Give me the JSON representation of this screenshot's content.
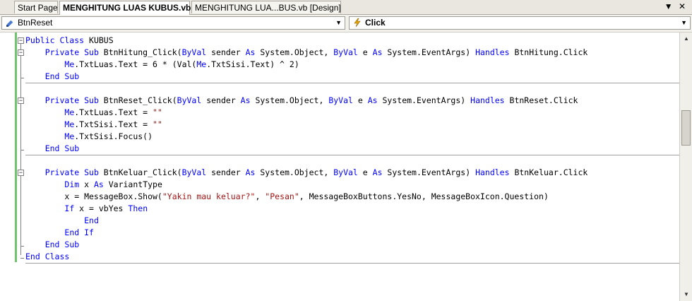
{
  "tabs": [
    {
      "label": "Start Page"
    },
    {
      "label": "MENGHITUNG LUAS KUBUS.vb"
    },
    {
      "label": "MENGHITUNG LUA...BUS.vb [Design]"
    }
  ],
  "tab_controls": {
    "dropdown": "▼",
    "close": "✕"
  },
  "navbar": {
    "object_combo": {
      "value": "BtnReset",
      "icon": "object-icon"
    },
    "member_combo": {
      "value": "Click",
      "icon": "lightning-icon"
    }
  },
  "code_lines": [
    [
      {
        "t": "kw",
        "v": "Public Class"
      },
      {
        "t": "p",
        "v": " KUBUS"
      }
    ],
    [
      {
        "t": "p",
        "v": "    "
      },
      {
        "t": "kw",
        "v": "Private Sub"
      },
      {
        "t": "p",
        "v": " BtnHitung_Click("
      },
      {
        "t": "kw",
        "v": "ByVal"
      },
      {
        "t": "p",
        "v": " sender "
      },
      {
        "t": "kw",
        "v": "As"
      },
      {
        "t": "p",
        "v": " System.Object, "
      },
      {
        "t": "kw",
        "v": "ByVal"
      },
      {
        "t": "p",
        "v": " e "
      },
      {
        "t": "kw",
        "v": "As"
      },
      {
        "t": "p",
        "v": " System.EventArgs) "
      },
      {
        "t": "kw",
        "v": "Handles"
      },
      {
        "t": "p",
        "v": " BtnHitung.Click"
      }
    ],
    [
      {
        "t": "p",
        "v": "        "
      },
      {
        "t": "kw",
        "v": "Me"
      },
      {
        "t": "p",
        "v": ".TxtLuas.Text = 6 * (Val("
      },
      {
        "t": "kw",
        "v": "Me"
      },
      {
        "t": "p",
        "v": ".TxtSisi.Text) ^ 2)"
      }
    ],
    [
      {
        "t": "p",
        "v": "    "
      },
      {
        "t": "kw",
        "v": "End Sub"
      }
    ],
    [
      {
        "t": "p",
        "v": ""
      }
    ],
    [
      {
        "t": "p",
        "v": "    "
      },
      {
        "t": "kw",
        "v": "Private Sub"
      },
      {
        "t": "p",
        "v": " BtnReset_Click("
      },
      {
        "t": "kw",
        "v": "ByVal"
      },
      {
        "t": "p",
        "v": " sender "
      },
      {
        "t": "kw",
        "v": "As"
      },
      {
        "t": "p",
        "v": " System.Object, "
      },
      {
        "t": "kw",
        "v": "ByVal"
      },
      {
        "t": "p",
        "v": " e "
      },
      {
        "t": "kw",
        "v": "As"
      },
      {
        "t": "p",
        "v": " System.EventArgs) "
      },
      {
        "t": "kw",
        "v": "Handles"
      },
      {
        "t": "p",
        "v": " BtnReset.Click"
      }
    ],
    [
      {
        "t": "p",
        "v": "        "
      },
      {
        "t": "kw",
        "v": "Me"
      },
      {
        "t": "p",
        "v": ".TxtLuas.Text = "
      },
      {
        "t": "str",
        "v": "\"\""
      }
    ],
    [
      {
        "t": "p",
        "v": "        "
      },
      {
        "t": "kw",
        "v": "Me"
      },
      {
        "t": "p",
        "v": ".TxtSisi.Text = "
      },
      {
        "t": "str",
        "v": "\"\""
      }
    ],
    [
      {
        "t": "p",
        "v": "        "
      },
      {
        "t": "kw",
        "v": "Me"
      },
      {
        "t": "p",
        "v": ".TxtSisi.Focus()"
      }
    ],
    [
      {
        "t": "p",
        "v": "    "
      },
      {
        "t": "kw",
        "v": "End Sub"
      }
    ],
    [
      {
        "t": "p",
        "v": ""
      }
    ],
    [
      {
        "t": "p",
        "v": "    "
      },
      {
        "t": "kw",
        "v": "Private Sub"
      },
      {
        "t": "p",
        "v": " BtnKeluar_Click("
      },
      {
        "t": "kw",
        "v": "ByVal"
      },
      {
        "t": "p",
        "v": " sender "
      },
      {
        "t": "kw",
        "v": "As"
      },
      {
        "t": "p",
        "v": " System.Object, "
      },
      {
        "t": "kw",
        "v": "ByVal"
      },
      {
        "t": "p",
        "v": " e "
      },
      {
        "t": "kw",
        "v": "As"
      },
      {
        "t": "p",
        "v": " System.EventArgs) "
      },
      {
        "t": "kw",
        "v": "Handles"
      },
      {
        "t": "p",
        "v": " BtnKeluar.Click"
      }
    ],
    [
      {
        "t": "p",
        "v": "        "
      },
      {
        "t": "kw",
        "v": "Dim"
      },
      {
        "t": "p",
        "v": " x "
      },
      {
        "t": "kw",
        "v": "As"
      },
      {
        "t": "p",
        "v": " VariantType"
      }
    ],
    [
      {
        "t": "p",
        "v": "        x = MessageBox.Show("
      },
      {
        "t": "str",
        "v": "\"Yakin mau keluar?\""
      },
      {
        "t": "p",
        "v": ", "
      },
      {
        "t": "str",
        "v": "\"Pesan\""
      },
      {
        "t": "p",
        "v": ", MessageBoxButtons.YesNo, MessageBoxIcon.Question)"
      }
    ],
    [
      {
        "t": "p",
        "v": "        "
      },
      {
        "t": "kw",
        "v": "If"
      },
      {
        "t": "p",
        "v": " x = vbYes "
      },
      {
        "t": "kw",
        "v": "Then"
      }
    ],
    [
      {
        "t": "p",
        "v": "            "
      },
      {
        "t": "kw",
        "v": "End"
      }
    ],
    [
      {
        "t": "p",
        "v": "        "
      },
      {
        "t": "kw",
        "v": "End If"
      }
    ],
    [
      {
        "t": "p",
        "v": "    "
      },
      {
        "t": "kw",
        "v": "End Sub"
      }
    ],
    [
      {
        "t": "kw",
        "v": "End Class"
      }
    ]
  ],
  "colors": {
    "keyword": "#0000ff",
    "string": "#a31515",
    "modified_bar": "#6dc46b"
  }
}
